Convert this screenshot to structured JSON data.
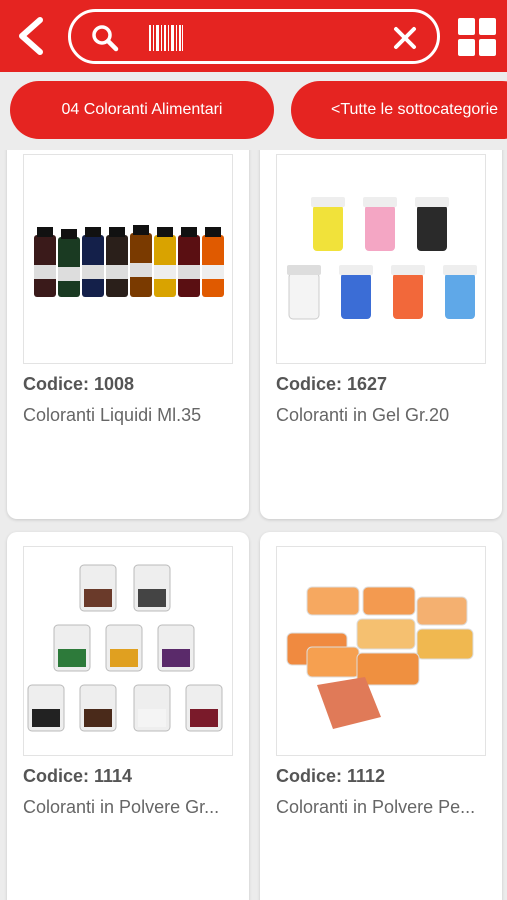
{
  "search": {
    "value": ""
  },
  "chips": [
    "04 Coloranti Alimentari",
    "<Tutte le sottocategorie"
  ],
  "products": [
    {
      "code": "Codice: 1008",
      "name": "Coloranti Liquidi Ml.35"
    },
    {
      "code": "Codice: 1627",
      "name": "Coloranti in Gel Gr.20"
    },
    {
      "code": "Codice: 1114",
      "name": "Coloranti in Polvere Gr..."
    },
    {
      "code": "Codice: 1112",
      "name": "Coloranti in Polvere Pe..."
    }
  ],
  "colors": {
    "brand": "#e52421",
    "background": "#ececec"
  }
}
